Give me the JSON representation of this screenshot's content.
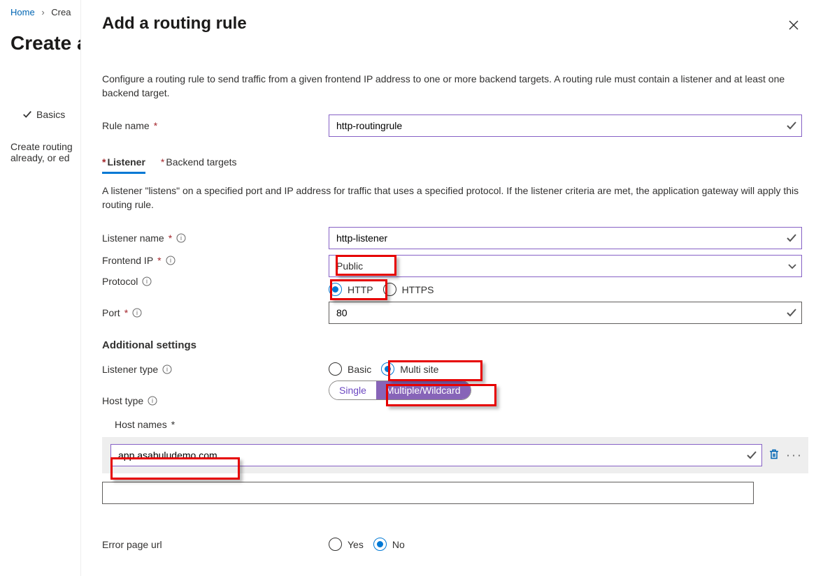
{
  "breadcrumb": {
    "home": "Home",
    "create": "Crea"
  },
  "page_title_visible": "Create a",
  "step_basics": "Basics",
  "subtext": "Create routing already, or ed",
  "panel": {
    "title": "Add a routing rule",
    "desc": "Configure a routing rule to send traffic from a given frontend IP address to one or more backend targets. A routing rule must contain a listener and at least one backend target.",
    "rule_name_label": "Rule name",
    "rule_name_value": "http-routingrule",
    "tabs": {
      "listener": "Listener",
      "backend": "Backend targets"
    },
    "tab_desc": "A listener \"listens\" on a specified port and IP address for traffic that uses a specified protocol. If the listener criteria are met, the application gateway will apply this routing rule.",
    "listener_name_label": "Listener name",
    "listener_name_value": "http-listener",
    "frontend_ip_label": "Frontend IP",
    "frontend_ip_value": "Public",
    "protocol_label": "Protocol",
    "protocol_http": "HTTP",
    "protocol_https": "HTTPS",
    "port_label": "Port",
    "port_value": "80",
    "additional_settings": "Additional settings",
    "listener_type_label": "Listener type",
    "listener_type_basic": "Basic",
    "listener_type_multi": "Multi site",
    "host_type_label": "Host type",
    "host_type_single": "Single",
    "host_type_multiple": "Multiple/Wildcard",
    "host_names_label": "Host names",
    "host_name_value": "app.asabuludemo.com",
    "error_page_label": "Error page url",
    "error_page_yes": "Yes",
    "error_page_no": "No"
  }
}
